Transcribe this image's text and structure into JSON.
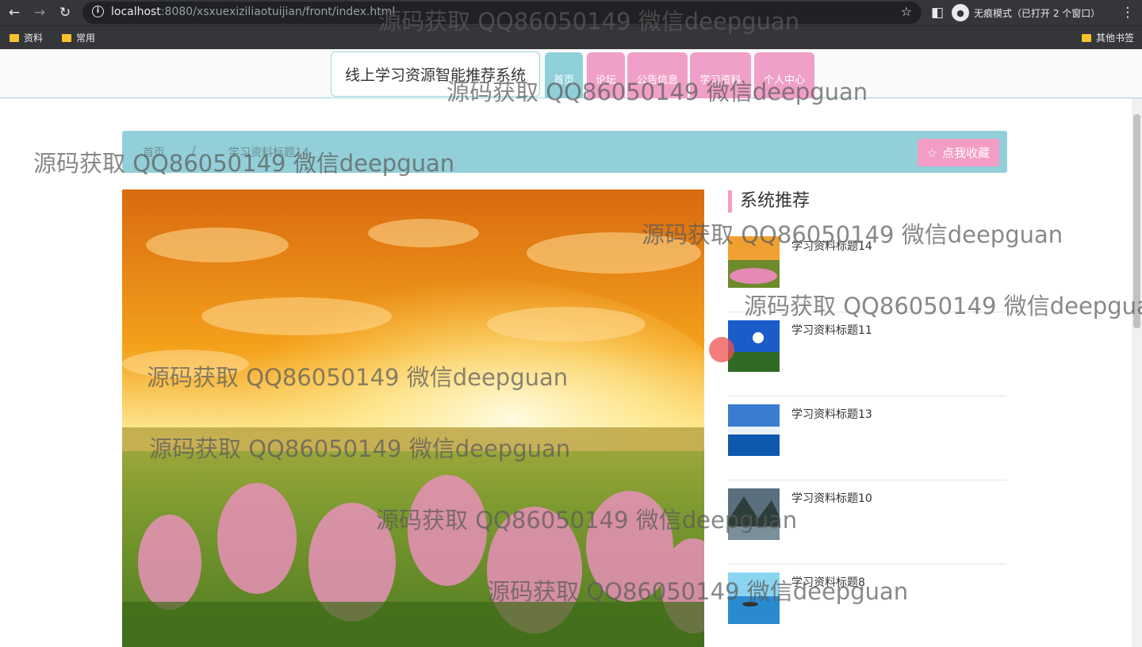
{
  "browser": {
    "url_host": "localhost",
    "url_rest": ":8080/xsxuexiziliaotuijian/front/index.html",
    "incognito_label": "无痕模式（已打开 2 个窗口）",
    "bookmarks": [
      "资料",
      "常用"
    ],
    "other_bookmarks": "其他书签"
  },
  "site": {
    "brand": "线上学习资源智能推荐系统",
    "nav": [
      {
        "label": "首页",
        "active": true
      },
      {
        "label": "论坛",
        "active": false
      },
      {
        "label": "公告信息",
        "active": false
      },
      {
        "label": "学习资料",
        "active": false
      },
      {
        "label": "个人中心",
        "active": false
      }
    ]
  },
  "breadcrumb": {
    "home": "首页",
    "sep": "/",
    "current": "学习资料标题14",
    "favorite_button": "点我收藏"
  },
  "recommend": {
    "title": "系统推荐",
    "items": [
      {
        "label": "学习资料标题14"
      },
      {
        "label": "学习资料标题11"
      },
      {
        "label": "学习资料标题13"
      },
      {
        "label": "学习资料标题10"
      },
      {
        "label": "学习资料标题8"
      }
    ]
  },
  "watermark": "源码获取 QQ86050149 微信deepguan"
}
